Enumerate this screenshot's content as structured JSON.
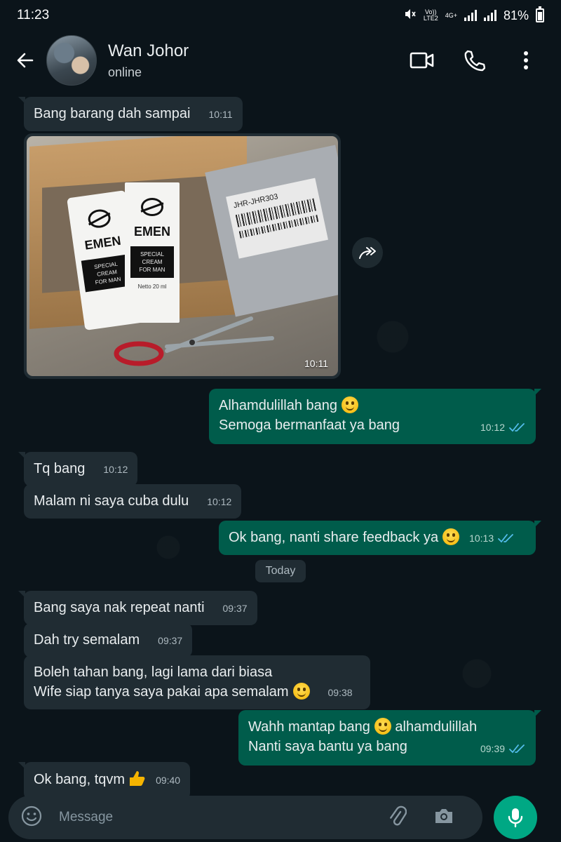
{
  "status_bar": {
    "time": "11:23",
    "volte": "Vo))",
    "lte": "LTE2",
    "net": "4G+",
    "battery": "81%"
  },
  "header": {
    "name": "Wan Johor",
    "status": "online"
  },
  "messages": [
    {
      "dir": "in",
      "text": "Bang barang dah sampai",
      "time": "10:11"
    },
    {
      "dir": "in",
      "type": "image",
      "time": "10:11",
      "image_text": {
        "brand": "EMEN",
        "label_line1": "SPECIAL CREAM",
        "label_line2": "FOR MAN",
        "netto": "Netto 20 ml",
        "shipping_code": "JHR-JHR303"
      }
    },
    {
      "dir": "out",
      "lines": [
        "Alhamdulillah bang",
        "Semoga bermanfaat ya bang"
      ],
      "time": "10:12"
    },
    {
      "dir": "in",
      "text": "Tq bang",
      "time": "10:12"
    },
    {
      "dir": "in",
      "text": "Malam ni saya cuba dulu",
      "time": "10:12"
    },
    {
      "dir": "out",
      "text": "Ok bang, nanti share feedback ya",
      "time": "10:13"
    },
    {
      "dir": "in",
      "text": "Bang saya nak repeat nanti",
      "time": "09:37"
    },
    {
      "dir": "in",
      "text": "Dah try semalam",
      "time": "09:37"
    },
    {
      "dir": "in",
      "lines": [
        "Boleh tahan bang, lagi lama dari biasa",
        "Wife siap tanya saya pakai apa semalam"
      ],
      "time": "09:38"
    },
    {
      "dir": "out",
      "lines": [
        "Wahh mantap bang",
        "alhamdulillah",
        "Nanti saya bantu ya bang"
      ],
      "time": "09:39"
    },
    {
      "dir": "in",
      "text": "Ok bang, tqvm",
      "time": "09:40"
    }
  ],
  "date_separator": "Today",
  "input": {
    "placeholder": "Message"
  },
  "colors": {
    "background": "#0b141a",
    "incoming_bubble": "#202c33",
    "outgoing_bubble": "#005c4b",
    "read_ticks": "#53bdeb",
    "accent": "#00a884"
  },
  "icons": {
    "back": "arrow-left-icon",
    "video": "video-camera-icon",
    "call": "phone-icon",
    "menu": "more-vertical-icon",
    "forward": "forward-icon",
    "emoji": "emoji-icon",
    "attach": "paperclip-icon",
    "camera": "camera-icon",
    "mic": "microphone-icon"
  }
}
